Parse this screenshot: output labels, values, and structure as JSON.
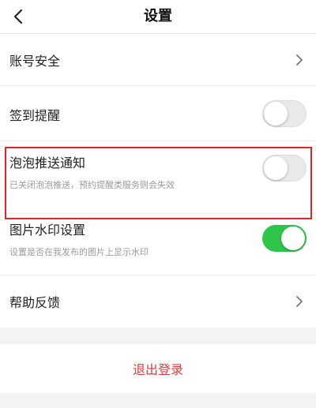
{
  "header": {
    "title": "设置",
    "back_icon": "chevron-left-icon"
  },
  "settings": {
    "account_security": {
      "label": "账号安全"
    },
    "checkin_reminder": {
      "label": "签到提醒",
      "enabled": false
    },
    "bubble_push": {
      "label": "泡泡推送通知",
      "description": "已关闭泡泡推送，预约提醒类服务则会失效",
      "enabled": false
    },
    "image_watermark": {
      "label": "图片水印设置",
      "description": "设置是否在我发布的图片上显示水印",
      "enabled": true
    },
    "help_feedback": {
      "label": "帮助反馈"
    }
  },
  "logout": {
    "label": "退出登录"
  },
  "colors": {
    "accent_red": "#e63b3b",
    "highlight_border": "#e0242c",
    "toggle_on": "#2ec54a",
    "toggle_off": "#e9e9e9"
  }
}
